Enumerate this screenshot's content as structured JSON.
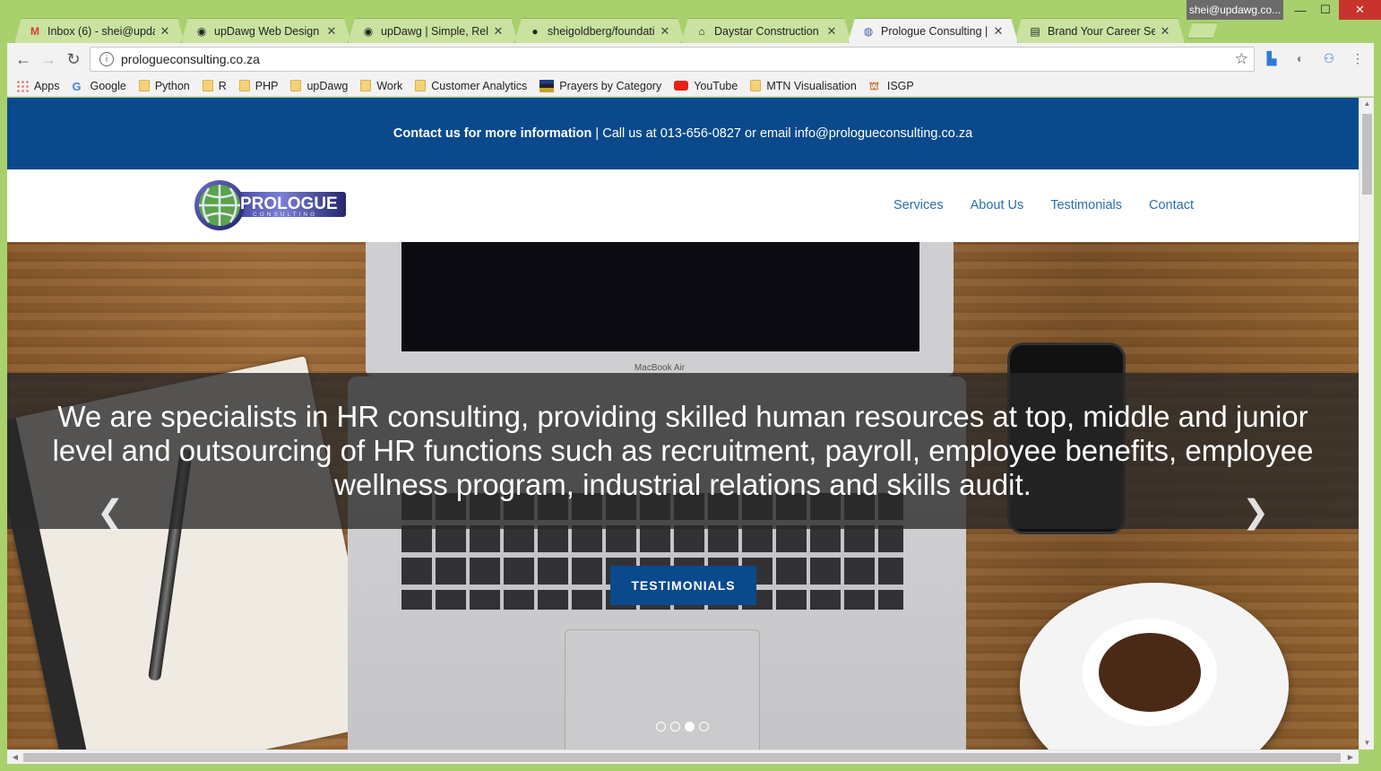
{
  "browser": {
    "profile": "shei@updawg.co...",
    "tabs": [
      {
        "title": "Inbox (6) - shei@updaw",
        "icon": "gmail-icon"
      },
      {
        "title": "upDawg Web Design",
        "icon": "updawg-icon"
      },
      {
        "title": "upDawg | Simple, Relial",
        "icon": "updawg-icon"
      },
      {
        "title": "sheigoldberg/foundatic",
        "icon": "github-icon"
      },
      {
        "title": "Daystar Construction | F",
        "icon": "home-icon"
      },
      {
        "title": "Prologue Consulting | Y",
        "icon": "prologue-icon"
      },
      {
        "title": "Brand Your Career Serv",
        "icon": "brand-icon"
      }
    ],
    "address": "prologueconsulting.co.za",
    "bookmarks": [
      {
        "label": "Apps",
        "icon": "apps-icon"
      },
      {
        "label": "Google",
        "icon": "google-icon"
      },
      {
        "label": "Python",
        "icon": "folder-icon"
      },
      {
        "label": "R",
        "icon": "folder-icon"
      },
      {
        "label": "PHP",
        "icon": "folder-icon"
      },
      {
        "label": "upDawg",
        "icon": "folder-icon"
      },
      {
        "label": "Work",
        "icon": "folder-icon"
      },
      {
        "label": "Customer Analytics",
        "icon": "folder-icon"
      },
      {
        "label": "Prayers by Category",
        "icon": "flag-icon"
      },
      {
        "label": "YouTube",
        "icon": "youtube-icon"
      },
      {
        "label": "MTN Visualisation",
        "icon": "folder-icon"
      },
      {
        "label": "ISGP",
        "icon": "isgp-icon"
      }
    ]
  },
  "site": {
    "topbar": {
      "bold": "Contact us for more information",
      "rest": " | Call us at 013-656-0827 or email info@prologueconsulting.co.za"
    },
    "logo": {
      "main": "PROLOGUE",
      "sub": "CONSULTING"
    },
    "nav": [
      "Services",
      "About Us",
      "Testimonials",
      "Contact"
    ],
    "hero": {
      "caption": "We are specialists in HR consulting, providing skilled human resources at top, middle and junior level and outsourcing of HR functions such as recruitment, payroll, employee benefits, employee wellness program, industrial relations and skills audit.",
      "cta": "TESTIMONIALS",
      "laptop_brand": "MacBook Air",
      "slide_count": 4,
      "active_slide": 3
    },
    "colors": {
      "brand_blue": "#0a4a8c",
      "link_blue": "#2a6fb0"
    }
  }
}
